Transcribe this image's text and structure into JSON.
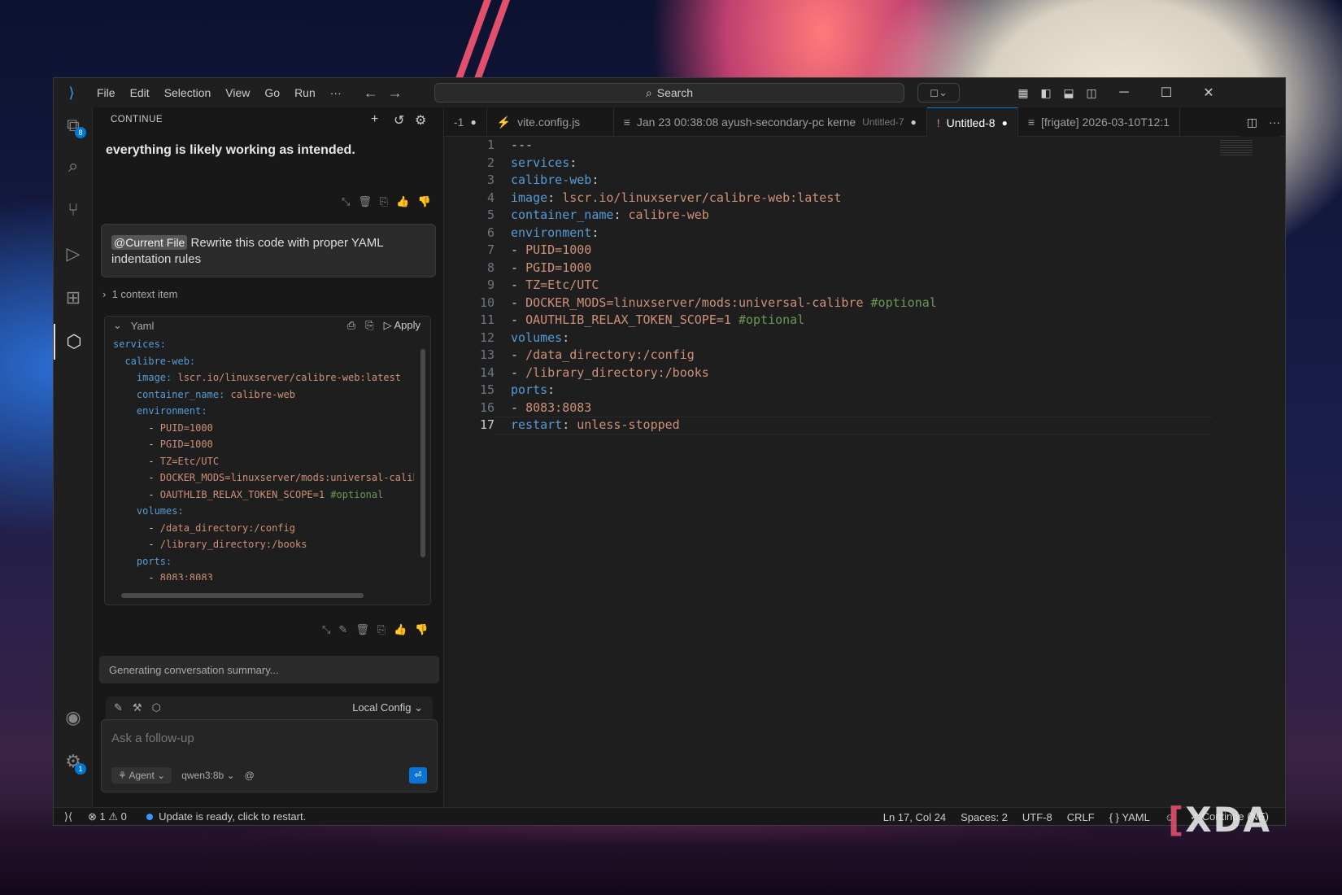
{
  "menu": [
    "File",
    "Edit",
    "Selection",
    "View",
    "Go",
    "Run",
    "···"
  ],
  "search": {
    "label": "Search"
  },
  "explorer_badge": "8",
  "settings_badge": "1",
  "sidebar": {
    "title": "CONTINUE",
    "assistant_text": "everything is likely working as intended.",
    "user_chip": "@Current File",
    "user_text": "Rewrite this code with proper YAML indentation rules",
    "context": "1 context item",
    "code_lang": "Yaml",
    "apply": "Apply",
    "code_lines": [
      [
        "services:"
      ],
      [
        "  calibre-web:"
      ],
      [
        "    image: ",
        "lscr.io/linuxserver/calibre-web:latest"
      ],
      [
        "    container_name: ",
        "calibre-web"
      ],
      [
        "    environment:"
      ],
      [
        "      - ",
        "PUID=1000"
      ],
      [
        "      - ",
        "PGID=1000"
      ],
      [
        "      - ",
        "TZ=Etc/UTC"
      ],
      [
        "      - ",
        "DOCKER_MODS=linuxserver/mods:universal-calibr"
      ],
      [
        "      - ",
        "OAUTHLIB_RELAX_TOKEN_SCOPE=1",
        " #optional"
      ],
      [
        "    volumes:"
      ],
      [
        "      - ",
        "/data_directory:/config"
      ],
      [
        "      - ",
        "/library_directory:/books"
      ],
      [
        "    ports:"
      ],
      [
        "      - ",
        "8083:8083"
      ],
      [
        "    restart: ",
        "unless-stopped"
      ]
    ],
    "generating": "Generating conversation summary...",
    "config": "Local Config",
    "input_placeholder": "Ask a follow-up",
    "mode": "Agent",
    "model": "qwen3:8b",
    "at": "@"
  },
  "tabs": [
    {
      "label": "-1",
      "dirty": "●"
    },
    {
      "label": "vite.config.js"
    },
    {
      "label": "Jan 23 00:38:08 ayush-secondary-pc kerne",
      "sub": "Untitled-7",
      "dirty": "●"
    },
    {
      "label": "Untitled-8",
      "dirty": "●",
      "active": true
    },
    {
      "label": "[frigate] 2026-03-10T12:1"
    }
  ],
  "editor": {
    "current_line": 17,
    "lines": [
      [
        [
          "p",
          "---"
        ]
      ],
      [
        [
          "k",
          "services"
        ],
        [
          "p",
          ":"
        ]
      ],
      [
        [
          "k",
          "calibre-web"
        ],
        [
          "p",
          ":"
        ]
      ],
      [
        [
          "k",
          "image"
        ],
        [
          "p",
          ": "
        ],
        [
          "s",
          "lscr.io/linuxserver/calibre-web:latest"
        ]
      ],
      [
        [
          "k",
          "container_name"
        ],
        [
          "p",
          ": "
        ],
        [
          "s",
          "calibre-web"
        ]
      ],
      [
        [
          "k",
          "environment"
        ],
        [
          "p",
          ":"
        ]
      ],
      [
        [
          "p",
          "- "
        ],
        [
          "s",
          "PUID=1000"
        ]
      ],
      [
        [
          "p",
          "- "
        ],
        [
          "s",
          "PGID=1000"
        ]
      ],
      [
        [
          "p",
          "- "
        ],
        [
          "s",
          "TZ=Etc/UTC"
        ]
      ],
      [
        [
          "p",
          "- "
        ],
        [
          "s",
          "DOCKER_MODS=linuxserver/mods:universal-calibre"
        ],
        [
          "c",
          " #optional"
        ]
      ],
      [
        [
          "p",
          "- "
        ],
        [
          "s",
          "OAUTHLIB_RELAX_TOKEN_SCOPE=1"
        ],
        [
          "c",
          " #optional"
        ]
      ],
      [
        [
          "k",
          "volumes"
        ],
        [
          "p",
          ":"
        ]
      ],
      [
        [
          "p",
          "- "
        ],
        [
          "s",
          "/data_directory:/config"
        ]
      ],
      [
        [
          "p",
          "- "
        ],
        [
          "s",
          "/library_directory:/books"
        ]
      ],
      [
        [
          "k",
          "ports"
        ],
        [
          "p",
          ":"
        ]
      ],
      [
        [
          "p",
          "- "
        ],
        [
          "s",
          "8083:8083"
        ]
      ],
      [
        [
          "k",
          "restart"
        ],
        [
          "p",
          ": "
        ],
        [
          "s",
          "unless-stopped"
        ]
      ]
    ]
  },
  "status": {
    "errors": "1",
    "warnings": "0",
    "update": "Update is ready, click to restart.",
    "position": "Ln 17, Col 24",
    "spaces": "Spaces: 2",
    "encoding": "UTF-8",
    "eol": "CRLF",
    "lang": "YAML",
    "continue": "Continue (NE)"
  },
  "watermark": "XDA",
  "colors": {
    "accent": "#0078d4",
    "keyword": "#569cd6",
    "string": "#ce9178",
    "comment": "#6a9955"
  }
}
